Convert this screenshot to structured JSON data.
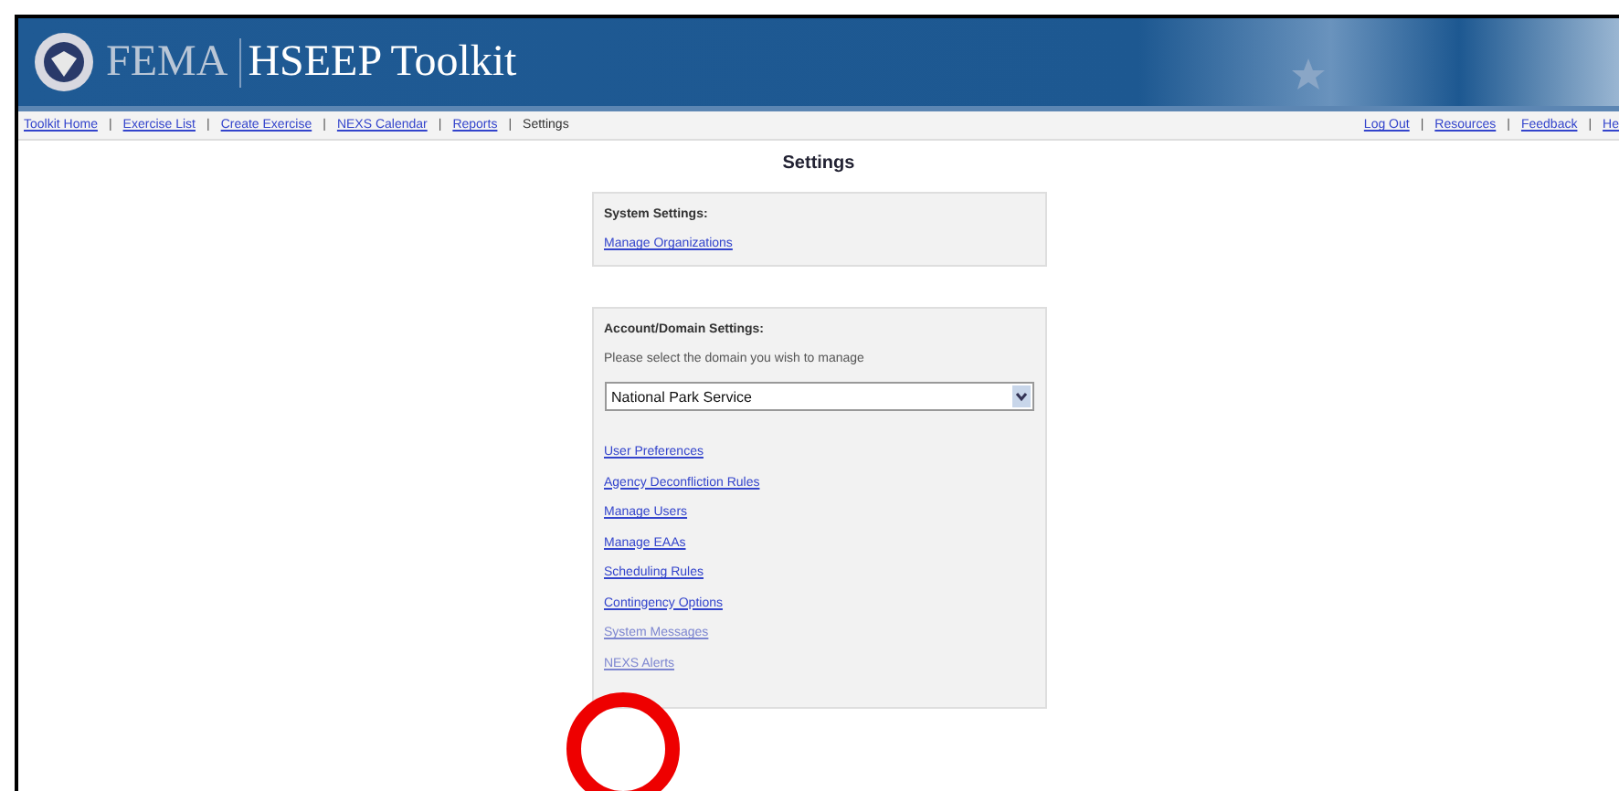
{
  "header": {
    "agency": "FEMA",
    "title": "HSEEP Toolkit"
  },
  "nav": {
    "separator": "|",
    "left": [
      {
        "label": "Toolkit Home",
        "current": false
      },
      {
        "label": "Exercise List",
        "current": false
      },
      {
        "label": "Create Exercise",
        "current": false
      },
      {
        "label": "NEXS Calendar",
        "current": false
      },
      {
        "label": "Reports",
        "current": false
      },
      {
        "label": "Settings",
        "current": true
      }
    ],
    "right": [
      "Log Out",
      "Resources",
      "Feedback",
      "He"
    ]
  },
  "page_title": "Settings",
  "system_settings": {
    "heading": "System Settings:",
    "links": [
      {
        "label": "Manage Organizations",
        "disabled": false
      }
    ]
  },
  "account_settings": {
    "heading": "Account/Domain Settings:",
    "prompt": "Please select the domain you wish to manage",
    "domain": "National Park Service",
    "links": [
      {
        "label": "User Preferences",
        "disabled": false
      },
      {
        "label": "Agency Deconfliction Rules",
        "disabled": false
      },
      {
        "label": "Manage Users",
        "disabled": false
      },
      {
        "label": "Manage EAAs",
        "disabled": false
      },
      {
        "label": "Scheduling Rules",
        "disabled": false
      },
      {
        "label": "Contingency Options",
        "disabled": false
      },
      {
        "label": "System Messages",
        "disabled": true
      },
      {
        "label": "NEXS Alerts",
        "disabled": true
      }
    ]
  },
  "annotation": {
    "highlight_circle": true
  }
}
